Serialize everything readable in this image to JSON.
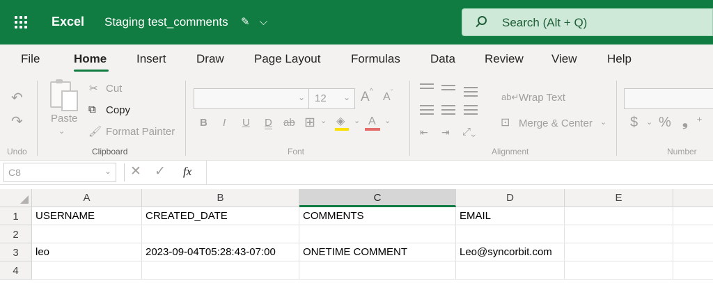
{
  "titlebar": {
    "app_name": "Excel",
    "doc_title": "Staging test_comments",
    "doc_icons": [
      "edit-icon",
      "chevron-down-icon"
    ],
    "search_placeholder": "Search (Alt + Q)"
  },
  "menu": {
    "tabs": [
      "File",
      "Home",
      "Insert",
      "Draw",
      "Page Layout",
      "Formulas",
      "Data",
      "Review",
      "View",
      "Help"
    ],
    "active": "Home"
  },
  "ribbon": {
    "undo_group": "Undo",
    "clipboard": {
      "paste": "Paste",
      "cut": "Cut",
      "copy": "Copy",
      "format_painter": "Format Painter",
      "group": "Clipboard"
    },
    "font": {
      "font_name": "",
      "size": "12",
      "group": "Font",
      "grow": "A",
      "shrink": "A",
      "bold": "B",
      "italic": "I",
      "underline": "U",
      "double_underline": "D",
      "strike": "ab",
      "font_color": "A"
    },
    "alignment": {
      "wrap": "Wrap Text",
      "merge": "Merge & Center",
      "group": "Alignment"
    },
    "number": {
      "currency": "$",
      "percent": "%",
      "group": "Number"
    }
  },
  "formula_bar": {
    "name_box": "C8",
    "cancel": "✕",
    "enter": "✓",
    "fx": "fx",
    "value": ""
  },
  "sheet": {
    "columns": [
      "A",
      "B",
      "C",
      "D",
      "E"
    ],
    "selected_column": "C",
    "rows": [
      {
        "num": "1",
        "cells": [
          "USERNAME",
          "CREATED_DATE",
          "COMMENTS",
          "EMAIL",
          ""
        ]
      },
      {
        "num": "2",
        "cells": [
          "",
          "",
          "",
          "",
          ""
        ]
      },
      {
        "num": "3",
        "cells": [
          "leo",
          "2023-09-04T05:28:43-07:00",
          "ONETIME COMMENT",
          "Leo@syncorbit.com",
          ""
        ]
      },
      {
        "num": "4",
        "cells": [
          "",
          "",
          "",
          "",
          ""
        ]
      }
    ]
  },
  "colors": {
    "brand": "#107c41",
    "ribbon_bg": "#f3f2f1",
    "search_bg": "#cfe9d8"
  }
}
